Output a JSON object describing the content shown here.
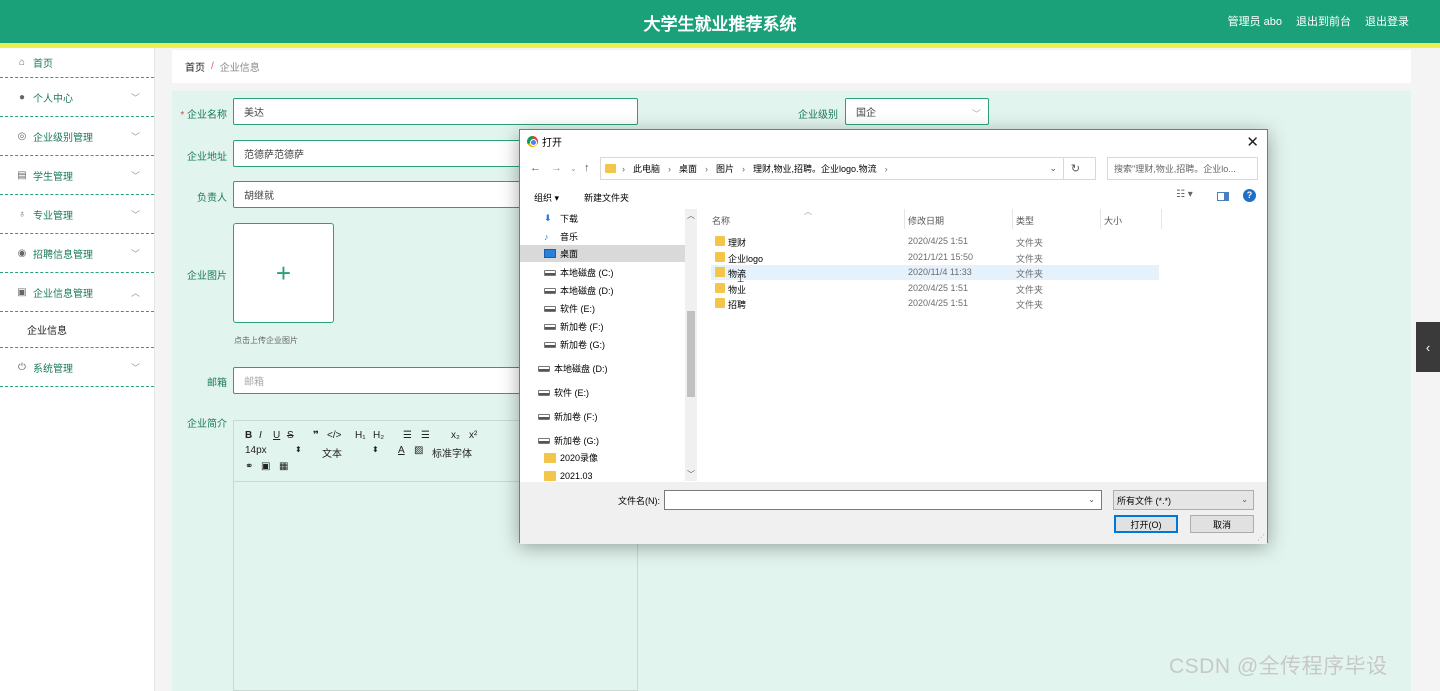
{
  "header": {
    "title": "大学生就业推荐系统",
    "user": "管理员 abo",
    "to_front": "退出到前台",
    "logout": "退出登录",
    "bg_color": "#1aa179",
    "stripe_color": "#ecf04f"
  },
  "sidebar": {
    "items": [
      {
        "label": "首页",
        "icon": "home-icon"
      },
      {
        "label": "个人中心",
        "icon": "user-icon"
      },
      {
        "label": "企业级别管理",
        "icon": "gauge-icon"
      },
      {
        "label": "学生管理",
        "icon": "card-icon"
      },
      {
        "label": "专业管理",
        "icon": "microphone-icon"
      },
      {
        "label": "招聘信息管理",
        "icon": "target-icon"
      },
      {
        "label": "企业信息管理",
        "icon": "clipboard-icon",
        "expanded": true
      },
      {
        "label": "系统管理",
        "icon": "power-icon"
      }
    ],
    "subitem": "企业信息"
  },
  "breadcrumb": {
    "home": "首页",
    "separator": "/",
    "current": "企业信息"
  },
  "form": {
    "name_label": "企业名称",
    "name_value": "美达",
    "level_label": "企业级别",
    "level_value": "国企",
    "address_label": "企业地址",
    "address_value": "范德萨范德萨",
    "manager_label": "负责人",
    "manager_value": "胡继就",
    "image_label": "企业图片",
    "upload_plus": "+",
    "upload_hint": "点击上传企业图片",
    "email_label": "邮箱",
    "email_placeholder": "邮箱",
    "intro_label": "企业简介",
    "editor_font_size": "14px",
    "editor_text_type": "文本",
    "editor_font": "标准字体"
  },
  "dialog": {
    "title": "打开",
    "path": [
      "此电脑",
      "桌面",
      "图片",
      "理财,物业,招聘。企业logo.物流"
    ],
    "search_placeholder": "搜索\"理财,物业,招聘。企业lo...",
    "organize": "组织 ▾",
    "new_folder": "新建文件夹",
    "tree": [
      {
        "label": "下载",
        "type": "download",
        "indent": 1
      },
      {
        "label": "音乐",
        "type": "music",
        "indent": 1
      },
      {
        "label": "桌面",
        "type": "desktop",
        "indent": 1,
        "selected": true
      },
      {
        "label": "本地磁盘 (C:)",
        "type": "drive",
        "indent": 1
      },
      {
        "label": "本地磁盘 (D:)",
        "type": "drive",
        "indent": 1
      },
      {
        "label": "软件 (E:)",
        "type": "drive",
        "indent": 1
      },
      {
        "label": "新加卷 (F:)",
        "type": "drive",
        "indent": 1
      },
      {
        "label": "新加卷 (G:)",
        "type": "drive",
        "indent": 1
      },
      {
        "label": "本地磁盘 (D:)",
        "type": "drive",
        "indent": 0
      },
      {
        "label": "软件 (E:)",
        "type": "drive",
        "indent": 0
      },
      {
        "label": "新加卷 (F:)",
        "type": "drive",
        "indent": 0
      },
      {
        "label": "新加卷 (G:)",
        "type": "drive",
        "indent": 0
      },
      {
        "label": "2020录像",
        "type": "folder",
        "indent": 1
      },
      {
        "label": "2021.03",
        "type": "folder",
        "indent": 1
      }
    ],
    "columns": {
      "name": "名称",
      "date": "修改日期",
      "type": "类型",
      "size": "大小"
    },
    "files": [
      {
        "name": "理财",
        "date": "2020/4/25 1:51",
        "type": "文件夹"
      },
      {
        "name": "企业logo",
        "date": "2021/1/21 15:50",
        "type": "文件夹"
      },
      {
        "name": "物流",
        "date": "2020/11/4 11:33",
        "type": "文件夹",
        "selected": true
      },
      {
        "name": "物业",
        "date": "2020/4/25 1:51",
        "type": "文件夹"
      },
      {
        "name": "招聘",
        "date": "2020/4/25 1:51",
        "type": "文件夹"
      }
    ],
    "filename_label": "文件名(N):",
    "filename_value": "",
    "filetype": "所有文件 (*.*)",
    "open_button": "打开(O)",
    "cancel_button": "取消"
  },
  "watermark": "CSDN @全传程序毕设"
}
